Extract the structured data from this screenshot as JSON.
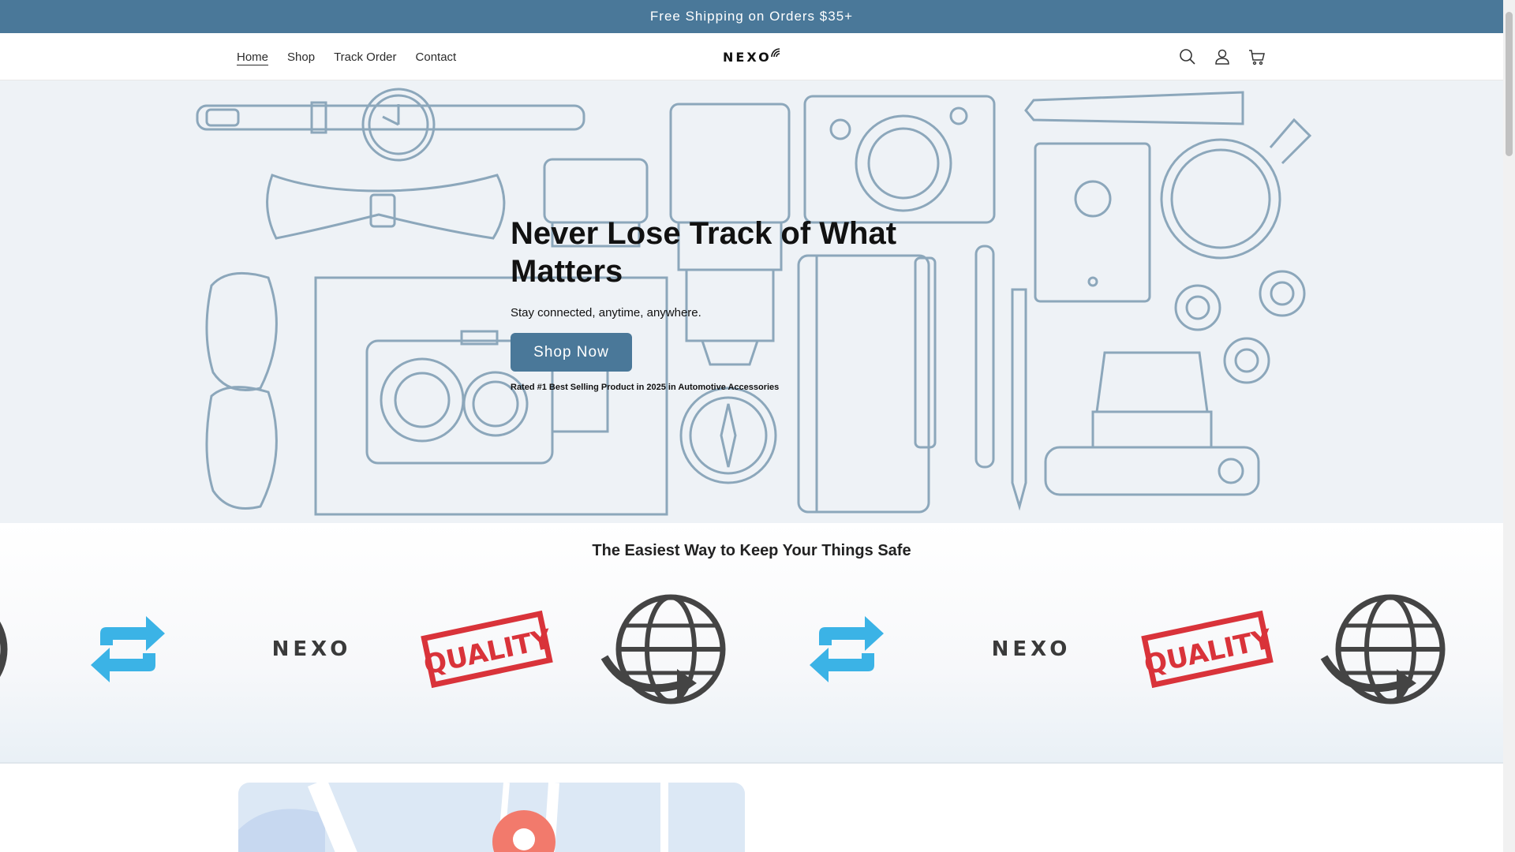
{
  "announcement": {
    "text": "Free Shipping on Orders $35+"
  },
  "nav": {
    "items": [
      {
        "label": "Home",
        "active": true
      },
      {
        "label": "Shop"
      },
      {
        "label": "Track Order"
      },
      {
        "label": "Contact"
      }
    ]
  },
  "brand": {
    "logo_text": "NEXO",
    "accent": "#4a7899"
  },
  "header_icons": [
    "search-icon",
    "account-icon",
    "cart-icon"
  ],
  "hero": {
    "title": "Never Lose Track of What Matters",
    "subtitle": "Stay connected, anytime, anywhere.",
    "button_label": "Shop Now",
    "note": "Rated #1 Best Selling Product in 2025 in Automotive Accessories"
  },
  "section2": {
    "title": "The Easiest Way to Keep Your Things Safe",
    "marquee_items": [
      "repeat-icon",
      "nexo-logo",
      "quality-stamp",
      "globe-icon",
      "repeat-icon",
      "nexo-logo",
      "quality-stamp",
      "globe-icon"
    ],
    "quality_text": "QUALITY"
  },
  "colors": {
    "announcement_bg": "#4a7899",
    "hero_bg": "#eef2f6",
    "line_art": "#8ca7bb",
    "repeat_icon": "#3bb3e6",
    "quality_red": "#d9333a"
  }
}
